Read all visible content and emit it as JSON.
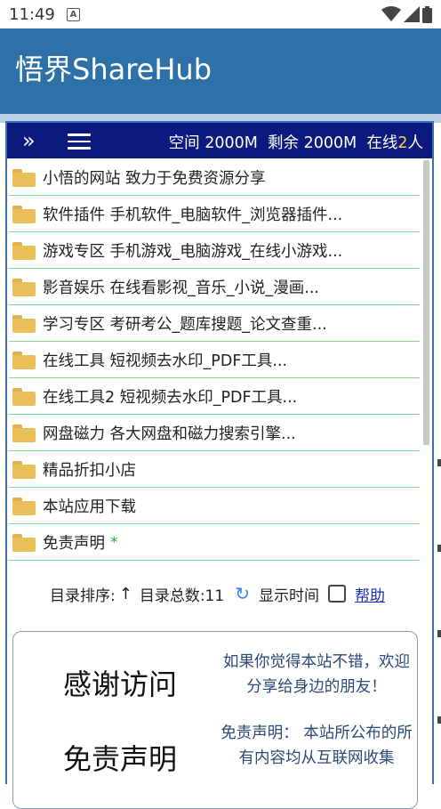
{
  "status_bar": {
    "time": "11:49",
    "notification_icon": "A"
  },
  "app": {
    "title": "悟界ShareHub"
  },
  "toolbar": {
    "chevron_icon": "»",
    "stats_space": "空间 2000M",
    "stats_remaining": "剩余 2000M",
    "stats_online_prefix": "在线",
    "stats_online_count": "2",
    "stats_online_suffix": "人"
  },
  "folders": [
    {
      "label": "小悟的网站 致力于免费资源分享"
    },
    {
      "label": "软件插件 手机软件_电脑软件_浏览器插件..."
    },
    {
      "label": "游戏专区 手机游戏_电脑游戏_在线小游戏..."
    },
    {
      "label": "影音娱乐 在线看影视_音乐_小说_漫画..."
    },
    {
      "label": "学习专区 考研考公_题库搜题_论文查重..."
    },
    {
      "label": "在线工具 短视频去水印_PDF工具..."
    },
    {
      "label": "在线工具2 短视频去水印_PDF工具..."
    },
    {
      "label": "网盘磁力 各大网盘和磁力搜索引擎..."
    },
    {
      "label": "精品折扣小店"
    },
    {
      "label": "本站应用下载"
    },
    {
      "label": "免责声明",
      "mark": "*"
    }
  ],
  "sortbar": {
    "sort_label": "目录排序:",
    "sort_arrow": "↑",
    "total_label": "目录总数:11",
    "refresh_icon": "↻",
    "show_time_label": "显示时间",
    "help_link": "帮助"
  },
  "info": {
    "heading_thanks": "感谢访问",
    "heading_disclaimer": "免责声明",
    "share_text": "如果你觉得本站不错，欢迎分享给身边的朋友！",
    "disclaimer_text": "免责声明： 本站所公布的所有内容均从互联网收集"
  },
  "colors": {
    "appbar": "#2e71a8",
    "toolbar": "#0b1a7c",
    "divider": "#7be08e",
    "folder": "#e9bf5a",
    "link": "#1a2fb8"
  }
}
